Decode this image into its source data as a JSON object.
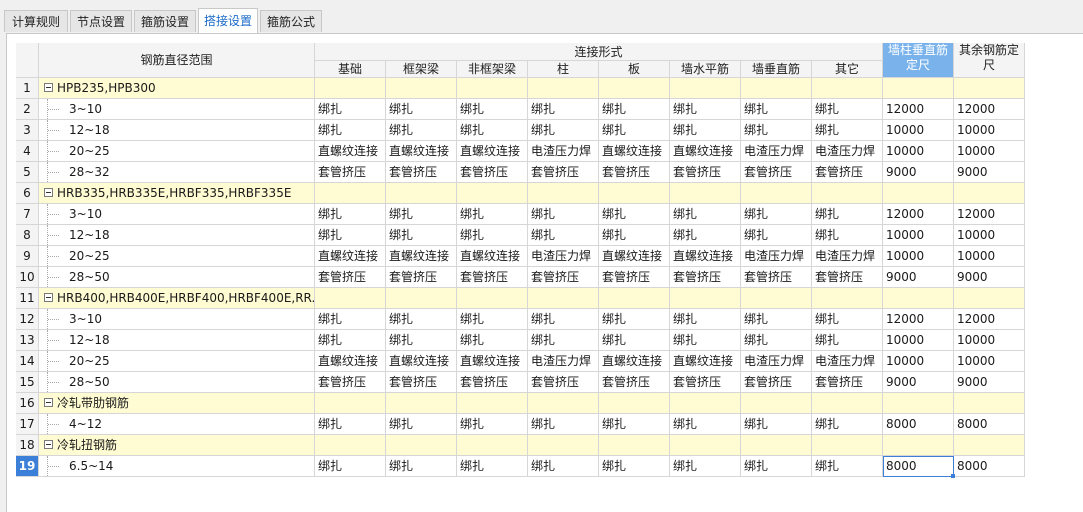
{
  "tabs": [
    "计算规则",
    "节点设置",
    "箍筋设置",
    "搭接设置",
    "箍筋公式"
  ],
  "active_tab": 3,
  "header": {
    "col0": "钢筋直径范围",
    "group": "连接形式",
    "subcols": [
      "基础",
      "框架梁",
      "非框架梁",
      "柱",
      "板",
      "墙水平筋",
      "墙垂直筋",
      "其它"
    ],
    "len1": "墙柱垂直筋定尺",
    "len2": "其余钢筋定尺"
  },
  "rows": [
    {
      "n": "1",
      "label": "HPB235,HPB300",
      "group": true
    },
    {
      "n": "2",
      "label": "3~10",
      "vals": [
        "绑扎",
        "绑扎",
        "绑扎",
        "绑扎",
        "绑扎",
        "绑扎",
        "绑扎",
        "绑扎"
      ],
      "len1": "12000",
      "len2": "12000"
    },
    {
      "n": "3",
      "label": "12~18",
      "vals": [
        "绑扎",
        "绑扎",
        "绑扎",
        "绑扎",
        "绑扎",
        "绑扎",
        "绑扎",
        "绑扎"
      ],
      "len1": "10000",
      "len2": "10000"
    },
    {
      "n": "4",
      "label": "20~25",
      "vals": [
        "直螺纹连接",
        "直螺纹连接",
        "直螺纹连接",
        "电渣压力焊",
        "直螺纹连接",
        "直螺纹连接",
        "电渣压力焊",
        "电渣压力焊"
      ],
      "len1": "10000",
      "len2": "10000"
    },
    {
      "n": "5",
      "label": "28~32",
      "vals": [
        "套管挤压",
        "套管挤压",
        "套管挤压",
        "套管挤压",
        "套管挤压",
        "套管挤压",
        "套管挤压",
        "套管挤压"
      ],
      "len1": "9000",
      "len2": "9000"
    },
    {
      "n": "6",
      "label": "HRB335,HRB335E,HRBF335,HRBF335E",
      "group": true
    },
    {
      "n": "7",
      "label": "3~10",
      "vals": [
        "绑扎",
        "绑扎",
        "绑扎",
        "绑扎",
        "绑扎",
        "绑扎",
        "绑扎",
        "绑扎"
      ],
      "len1": "12000",
      "len2": "12000"
    },
    {
      "n": "8",
      "label": "12~18",
      "vals": [
        "绑扎",
        "绑扎",
        "绑扎",
        "绑扎",
        "绑扎",
        "绑扎",
        "绑扎",
        "绑扎"
      ],
      "len1": "10000",
      "len2": "10000"
    },
    {
      "n": "9",
      "label": "20~25",
      "vals": [
        "直螺纹连接",
        "直螺纹连接",
        "直螺纹连接",
        "电渣压力焊",
        "直螺纹连接",
        "直螺纹连接",
        "电渣压力焊",
        "电渣压力焊"
      ],
      "len1": "10000",
      "len2": "10000"
    },
    {
      "n": "10",
      "label": "28~50",
      "vals": [
        "套管挤压",
        "套管挤压",
        "套管挤压",
        "套管挤压",
        "套管挤压",
        "套管挤压",
        "套管挤压",
        "套管挤压"
      ],
      "len1": "9000",
      "len2": "9000"
    },
    {
      "n": "11",
      "label": "HRB400,HRB400E,HRBF400,HRBF400E,RR...",
      "group": true
    },
    {
      "n": "12",
      "label": "3~10",
      "vals": [
        "绑扎",
        "绑扎",
        "绑扎",
        "绑扎",
        "绑扎",
        "绑扎",
        "绑扎",
        "绑扎"
      ],
      "len1": "12000",
      "len2": "12000"
    },
    {
      "n": "13",
      "label": "12~18",
      "vals": [
        "绑扎",
        "绑扎",
        "绑扎",
        "绑扎",
        "绑扎",
        "绑扎",
        "绑扎",
        "绑扎"
      ],
      "len1": "10000",
      "len2": "10000"
    },
    {
      "n": "14",
      "label": "20~25",
      "vals": [
        "直螺纹连接",
        "直螺纹连接",
        "直螺纹连接",
        "电渣压力焊",
        "直螺纹连接",
        "直螺纹连接",
        "电渣压力焊",
        "电渣压力焊"
      ],
      "len1": "10000",
      "len2": "10000"
    },
    {
      "n": "15",
      "label": "28~50",
      "vals": [
        "套管挤压",
        "套管挤压",
        "套管挤压",
        "套管挤压",
        "套管挤压",
        "套管挤压",
        "套管挤压",
        "套管挤压"
      ],
      "len1": "9000",
      "len2": "9000"
    },
    {
      "n": "16",
      "label": "冷轧带肋钢筋",
      "group": true
    },
    {
      "n": "17",
      "label": "4~12",
      "vals": [
        "绑扎",
        "绑扎",
        "绑扎",
        "绑扎",
        "绑扎",
        "绑扎",
        "绑扎",
        "绑扎"
      ],
      "len1": "8000",
      "len2": "8000"
    },
    {
      "n": "18",
      "label": "冷轧扭钢筋",
      "group": true
    },
    {
      "n": "19",
      "label": "6.5~14",
      "vals": [
        "绑扎",
        "绑扎",
        "绑扎",
        "绑扎",
        "绑扎",
        "绑扎",
        "绑扎",
        "绑扎"
      ],
      "len1": "8000",
      "len2": "8000",
      "selected": true
    }
  ]
}
